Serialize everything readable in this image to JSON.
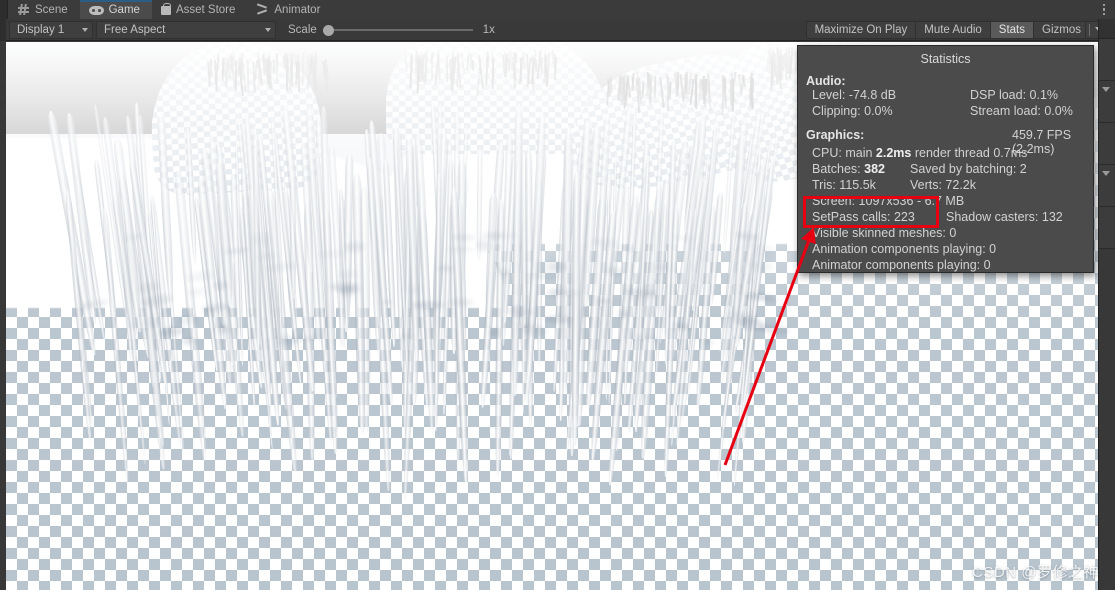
{
  "window": {
    "tabs": [
      {
        "label": "Scene",
        "icon": "grid-icon",
        "active": false
      },
      {
        "label": "Game",
        "icon": "gamepad-icon",
        "active": true
      },
      {
        "label": "Asset Store",
        "icon": "shopping-bag-icon",
        "active": false
      },
      {
        "label": "Animator",
        "icon": "animator-arrows-icon",
        "active": false
      }
    ],
    "kebab_menu": "more-options-icon"
  },
  "toolbar": {
    "display": "Display 1",
    "aspect": "Free Aspect",
    "scale_label": "Scale",
    "scale_value": "1x",
    "maximize_on_play": "Maximize On Play",
    "mute_audio": "Mute Audio",
    "stats": "Stats",
    "gizmos": "Gizmos"
  },
  "statistics": {
    "title": "Statistics",
    "audio": {
      "heading": "Audio:",
      "level": "Level: -74.8 dB",
      "dsp_load": "DSP load: 0.1%",
      "clipping": "Clipping: 0.0%",
      "stream_load": "Stream load: 0.0%"
    },
    "graphics": {
      "heading": "Graphics:",
      "fps": "459.7 FPS (2.2ms)",
      "cpu_prefix": "CPU: main ",
      "cpu_main": "2.2ms",
      "cpu_suffix": " render thread 0.7ms",
      "batches_label": "Batches: ",
      "batches_value": "382",
      "saved_by_batching": "Saved by batching: 2",
      "tris": "Tris: 115.5k",
      "verts": "Verts: 72.2k",
      "screen": "Screen: 1097x536 - 6.7 MB",
      "setpass_calls": "SetPass calls: 223",
      "shadow_casters": "Shadow casters: 132",
      "visible_skinned_meshes": "Visible skinned meshes: 0",
      "animation_components": "Animation components playing: 0",
      "animator_components": "Animator components playing: 0"
    }
  },
  "annotation": {
    "highlight_target": "SetPass calls: 223",
    "color": "#e60012"
  },
  "watermark": {
    "text": "CSDN @罗修之神"
  },
  "colors": {
    "editor_background": "#383838",
    "panel_background": "#4b4b4b",
    "active_tab": "#4b4b4b",
    "accent_blue": "#2c5d87",
    "annotation_red": "#e60012"
  }
}
